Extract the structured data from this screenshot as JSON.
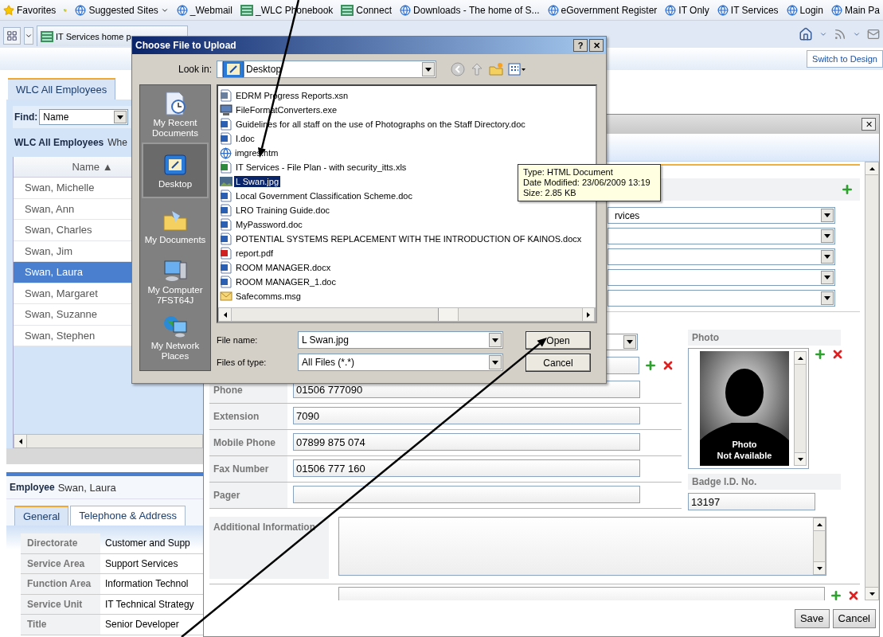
{
  "favorites_bar": {
    "label": "Favorites",
    "links": [
      {
        "label": "Suggested Sites",
        "kind": "web",
        "menu": true
      },
      {
        "label": "_Webmail",
        "kind": "web"
      },
      {
        "label": "_WLC Phonebook",
        "kind": "site"
      },
      {
        "label": "Connect",
        "kind": "site"
      },
      {
        "label": "Downloads - The home of S...",
        "kind": "web"
      },
      {
        "label": "eGovernment Register",
        "kind": "web"
      },
      {
        "label": "IT Only",
        "kind": "web"
      },
      {
        "label": "IT Services",
        "kind": "web"
      },
      {
        "label": "Login",
        "kind": "web"
      },
      {
        "label": "Main Pa",
        "kind": "web"
      }
    ]
  },
  "browser_tab": {
    "label": "IT Services home p"
  },
  "switch_link": "Switch to Design",
  "left_panel": {
    "tab": "WLC All Employees",
    "find": {
      "label": "Find:",
      "value": "Name"
    },
    "heading": "WLC All Employees",
    "heading_suffix": "Whe",
    "column": "Name",
    "sort_mark": "▲",
    "rows": [
      {
        "name": "Swan, Michelle",
        "selected": false
      },
      {
        "name": "Swan, Ann",
        "selected": false
      },
      {
        "name": "Swan, Charles",
        "selected": false
      },
      {
        "name": "Swan, Jim",
        "selected": false
      },
      {
        "name": "Swan, Laura",
        "selected": true
      },
      {
        "name": "Swan, Margaret",
        "selected": false
      },
      {
        "name": "Swan, Suzanne",
        "selected": false
      },
      {
        "name": "Swan, Stephen",
        "selected": false
      }
    ]
  },
  "employee": {
    "label": "Employee",
    "name": "Swan, Laura",
    "tabs": [
      {
        "label": "General",
        "selected": true
      },
      {
        "label": "Telephone & Address",
        "selected": false
      }
    ],
    "fields": [
      {
        "label": "Directorate",
        "value": "Customer and Supp"
      },
      {
        "label": "Service Area",
        "value": "Support Services"
      },
      {
        "label": "Function Area",
        "value": "Information Technol"
      },
      {
        "label": "Service Unit",
        "value": "IT Technical Strategy"
      },
      {
        "label": "Title",
        "value": "Senior Developer"
      }
    ]
  },
  "editor": {
    "close": "✕",
    "dropdowns": [
      {
        "kind": "filled",
        "value": "rvices"
      },
      {
        "kind": "blank"
      },
      {
        "kind": "blank"
      },
      {
        "kind": "blank"
      },
      {
        "kind": "blank"
      }
    ],
    "partial_rows": [
      {
        "kind": "select"
      },
      {
        "kind": "input"
      }
    ],
    "contact_fields": [
      {
        "label": "Phone",
        "value": "01506 777090"
      },
      {
        "label": "Extension",
        "value": "7090"
      },
      {
        "label": "Mobile Phone",
        "value": "07899 875 074"
      },
      {
        "label": "Fax Number",
        "value": "01506 777 160"
      },
      {
        "label": "Pager"
      }
    ],
    "photo": {
      "label": "Photo",
      "caption": [
        "Photo",
        "Not Available"
      ]
    },
    "badge": {
      "label": "Badge I.D. No.",
      "value": "13197"
    },
    "additional_info": {
      "label": "Additional Information"
    },
    "buttons": [
      "Save",
      "Cancel"
    ]
  },
  "dialog": {
    "title": "Choose File to Upload",
    "title_buttons": [
      "?",
      "✕"
    ],
    "look_in": {
      "label": "Look in:",
      "value": "Desktop"
    },
    "places": [
      {
        "label": "My Recent Documents",
        "kind": "recent",
        "selected": false
      },
      {
        "label": "Desktop",
        "kind": "desktop",
        "selected": true
      },
      {
        "label": "My Documents",
        "kind": "documents",
        "selected": false
      },
      {
        "label": "My Computer 7FST64J",
        "kind": "computer",
        "selected": false
      },
      {
        "label": "My Network Places",
        "kind": "network",
        "selected": false
      }
    ],
    "files": [
      {
        "name": "EDRM Progress Reports.xsn",
        "kind": "form",
        "selected": false
      },
      {
        "name": "FileFormatConverters.exe",
        "kind": "program",
        "selected": false
      },
      {
        "name": "Guidelines for all staff on the use of Photographs on the Staff Directory.doc",
        "kind": "document",
        "selected": false
      },
      {
        "name": "I.doc",
        "kind": "document",
        "selected": false
      },
      {
        "name": "imgres.htm",
        "kind": "web",
        "selected": false
      },
      {
        "name": "IT Services - File Plan - with security_itts.xls",
        "kind": "sheet",
        "selected": false
      },
      {
        "name": "L Swan.jpg",
        "kind": "image",
        "selected": true
      },
      {
        "name": "Local Government Classification Scheme.doc",
        "kind": "document",
        "selected": false
      },
      {
        "name": "LRO Training Guide.doc",
        "kind": "document",
        "selected": false
      },
      {
        "name": "MyPassword.doc",
        "kind": "document",
        "selected": false
      },
      {
        "name": "POTENTIAL SYSTEMS REPLACEMENT WITH THE INTRODUCTION OF KAINOS.docx",
        "kind": "document",
        "selected": false
      },
      {
        "name": "report.pdf",
        "kind": "pdf",
        "selected": false
      },
      {
        "name": "ROOM MANAGER.docx",
        "kind": "document",
        "selected": false
      },
      {
        "name": "ROOM MANAGER_1.doc",
        "kind": "document",
        "selected": false
      },
      {
        "name": "Safecomms.msg",
        "kind": "mail",
        "selected": false
      }
    ],
    "tooltip": [
      "Type: HTML Document",
      "Date Modified: 23/06/2009 13:19",
      "Size: 2.85 KB"
    ],
    "file_name": {
      "label": "File name:",
      "value": "L Swan.jpg"
    },
    "file_type": {
      "label": "Files of type:",
      "value": "All Files (*.*)"
    },
    "buttons": [
      "Open",
      "Cancel"
    ]
  }
}
